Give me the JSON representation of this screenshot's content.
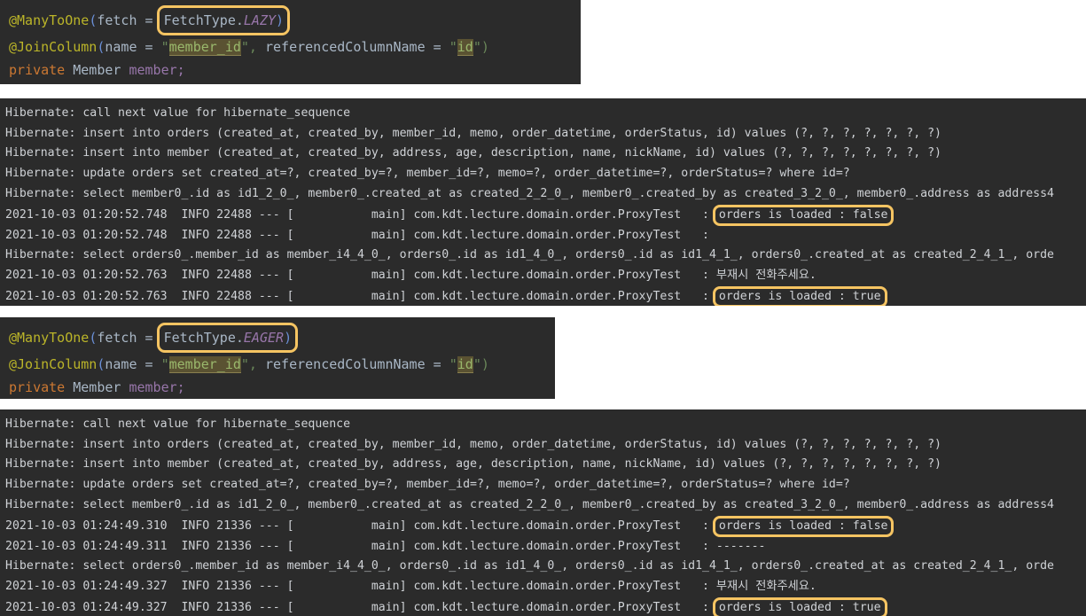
{
  "colors": {
    "panel_background": "#2b2b2b",
    "page_background": "#ffffff",
    "highlight_border": "#f5c462",
    "annotation": "#bbb529",
    "keyword": "#cc7832",
    "constant": "#9876aa",
    "string": "#6a8759",
    "string_highlight_bg": "#5a5232",
    "log_text": "#cfd2d6"
  },
  "lazy_code": {
    "title": "ManyToOne LAZY mapping",
    "lines": [
      {
        "annotation": "@ManyToOne",
        "open_paren": "(",
        "param": "fetch",
        "equals": " = ",
        "callout": {
          "class": "FetchType",
          "dot": ".",
          "constant": "LAZY",
          "close_paren": ")"
        }
      },
      {
        "annotation": "@JoinColumn",
        "open_paren": "(",
        "param": "name",
        "equals": " = ",
        "quote": "\"",
        "value_highlight": "member_id",
        "mid": "\", ",
        "param2": "referencedColumnName",
        "equals2": " = ",
        "quote2": "\"",
        "value_highlight2": "id",
        "tail": "\")"
      },
      {
        "keyword": "private",
        "type": "Member",
        "field": "member;"
      }
    ]
  },
  "eager_code": {
    "title": "ManyToOne EAGER mapping",
    "lines": [
      {
        "annotation": "@ManyToOne",
        "open_paren": "(",
        "param": "fetch",
        "equals": " = ",
        "callout": {
          "class": "FetchType",
          "dot": ".",
          "constant": "EAGER",
          "close_paren": ")"
        }
      },
      {
        "annotation": "@JoinColumn",
        "open_paren": "(",
        "param": "name",
        "equals": " = ",
        "quote": "\"",
        "value_highlight": "member_id",
        "mid": "\", ",
        "param2": "referencedColumnName",
        "equals2": " = ",
        "quote2": "\"",
        "value_highlight2": "id",
        "tail": "\")"
      },
      {
        "keyword": "private",
        "type": "Member",
        "field": "member;"
      }
    ]
  },
  "lazy_log": {
    "title": "LAZY fetch console output",
    "lines": [
      {
        "text": "Hibernate: call next value for hibernate_sequence"
      },
      {
        "text": "Hibernate: insert into orders (created_at, created_by, member_id, memo, order_datetime, orderStatus, id) values (?, ?, ?, ?, ?, ?, ?)"
      },
      {
        "text": "Hibernate: insert into member (created_at, created_by, address, age, description, name, nickName, id) values (?, ?, ?, ?, ?, ?, ?, ?)"
      },
      {
        "text": "Hibernate: update orders set created_at=?, created_by=?, member_id=?, memo=?, order_datetime=?, orderStatus=? where id=?"
      },
      {
        "text": "Hibernate: select member0_.id as id1_2_0_, member0_.created_at as created_2_2_0_, member0_.created_by as created_3_2_0_, member0_.address as address4"
      },
      {
        "prefix": "2021-10-03 01:20:52.748  INFO 22488 --- [           main] com.kdt.lecture.domain.order.ProxyTest   : ",
        "highlight": "orders is loaded : false",
        "suffix": ""
      },
      {
        "prefix": "2021-10-03 01:20:52.748  INFO 22488 --- [           main] com.kdt.lecture.domain.order.ProxyTest   : ",
        "highlight": "",
        "suffix": ""
      },
      {
        "text": "Hibernate: select orders0_.member_id as member_i4_4_0_, orders0_.id as id1_4_0_, orders0_.id as id1_4_1_, orders0_.created_at as created_2_4_1_, orde"
      },
      {
        "prefix": "2021-10-03 01:20:52.763  INFO 22488 --- [           main] com.kdt.lecture.domain.order.ProxyTest   : ",
        "highlight": "",
        "suffix": "부재시 전화주세요."
      },
      {
        "prefix": "2021-10-03 01:20:52.763  INFO 22488 --- [           main] com.kdt.lecture.domain.order.ProxyTest   : ",
        "highlight": "orders is loaded : true",
        "suffix": ""
      }
    ]
  },
  "eager_log": {
    "title": "EAGER fetch console output",
    "lines": [
      {
        "text": "Hibernate: call next value for hibernate_sequence"
      },
      {
        "text": "Hibernate: insert into orders (created_at, created_by, member_id, memo, order_datetime, orderStatus, id) values (?, ?, ?, ?, ?, ?, ?)"
      },
      {
        "text": "Hibernate: insert into member (created_at, created_by, address, age, description, name, nickName, id) values (?, ?, ?, ?, ?, ?, ?, ?)"
      },
      {
        "text": "Hibernate: update orders set created_at=?, created_by=?, member_id=?, memo=?, order_datetime=?, orderStatus=? where id=?"
      },
      {
        "text": "Hibernate: select member0_.id as id1_2_0_, member0_.created_at as created_2_2_0_, member0_.created_by as created_3_2_0_, member0_.address as address4"
      },
      {
        "prefix": "2021-10-03 01:24:49.310  INFO 21336 --- [           main] com.kdt.lecture.domain.order.ProxyTest   : ",
        "highlight": "orders is loaded : false",
        "suffix": ""
      },
      {
        "prefix": "2021-10-03 01:24:49.311  INFO 21336 --- [           main] com.kdt.lecture.domain.order.ProxyTest   : ",
        "highlight": "",
        "suffix": "-------"
      },
      {
        "text": "Hibernate: select orders0_.member_id as member_i4_4_0_, orders0_.id as id1_4_0_, orders0_.id as id1_4_1_, orders0_.created_at as created_2_4_1_, orde"
      },
      {
        "prefix": "2021-10-03 01:24:49.327  INFO 21336 --- [           main] com.kdt.lecture.domain.order.ProxyTest   : ",
        "highlight": "",
        "suffix": "부재시 전화주세요."
      },
      {
        "prefix": "2021-10-03 01:24:49.327  INFO 21336 --- [           main] com.kdt.lecture.domain.order.ProxyTest   : ",
        "highlight": "orders is loaded : true",
        "suffix": ""
      }
    ]
  }
}
